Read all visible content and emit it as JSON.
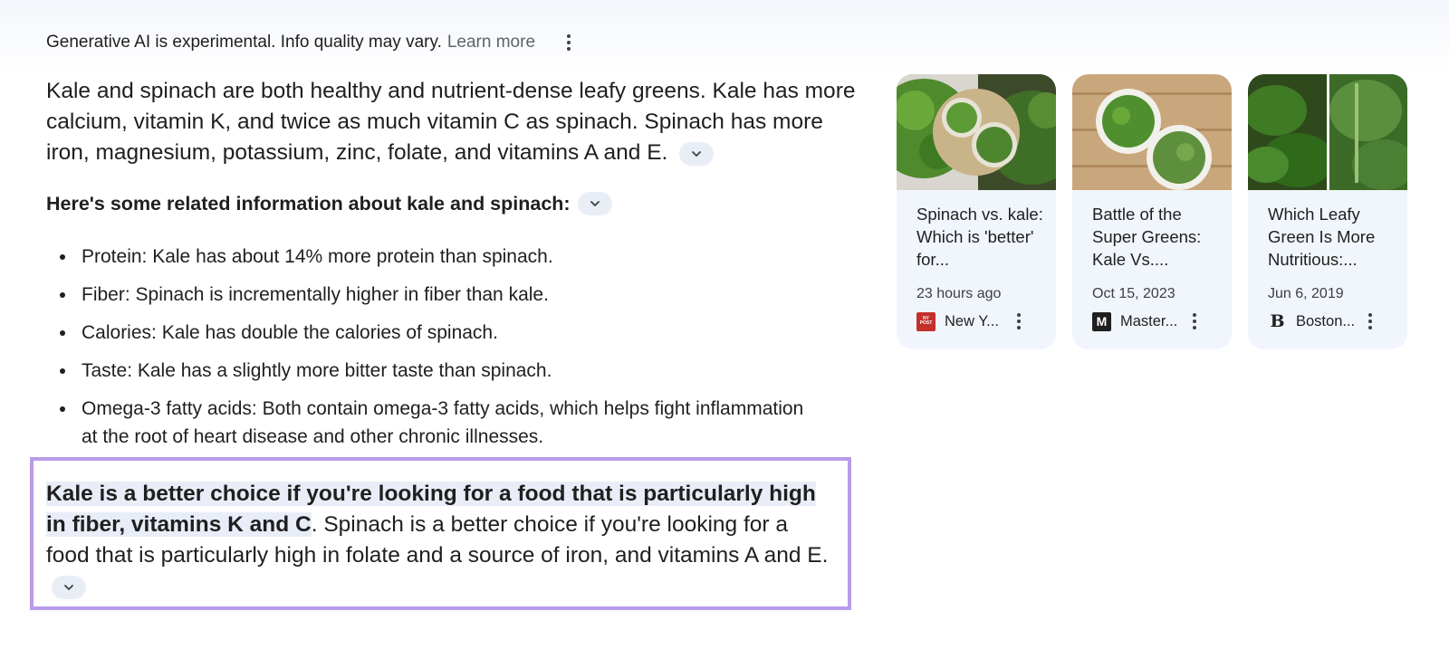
{
  "notice": {
    "text": "Generative AI is experimental. Info quality may vary.",
    "link": "Learn more",
    "menu_icon": "more-vert-icon"
  },
  "summary": "Kale and spinach are both healthy and nutrient-dense leafy greens. Kale has more calcium, vitamin K, and twice as much vitamin C as spinach. Spinach has more iron, magnesium, potassium, zinc, folate, and vitamins A and E.",
  "related_heading": "Here's some related information about kale and spinach:",
  "bullets": [
    "Protein: Kale has about 14% more protein than spinach.",
    "Fiber: Spinach is incrementally higher in fiber than kale.",
    "Calories: Kale has double the calories of spinach.",
    "Taste: Kale has a slightly more bitter taste than spinach.",
    "Omega-3 fatty acids: Both contain omega-3 fatty acids, which helps fight inflammation at the root of heart disease and other chronic illnesses."
  ],
  "conclusion": {
    "bold": "Kale is a better choice if you're looking for a food that is particularly high in fiber, vitamins K and C",
    "rest": ". Spinach is a better choice if you're looking for a food that is particularly high in folate and a source of iron, and vitamins A and E."
  },
  "cards": [
    {
      "title": "Spinach vs. kale: Which is 'better' for...",
      "date": "23 hours ago",
      "source": "New Y...",
      "favicon_label": "NEW YORK POST",
      "favicon_color": "#c4302b"
    },
    {
      "title": "Battle of the Super Greens: Kale Vs....",
      "date": "Oct 15, 2023",
      "source": "Master...",
      "favicon_label": "M",
      "favicon_color": "#1f1f1f"
    },
    {
      "title": "Which Leafy Green Is More Nutritious:...",
      "date": "Jun 6, 2019",
      "source": "Boston...",
      "favicon_label": "B",
      "favicon_color": "#ffffff"
    }
  ],
  "colors": {
    "highlight_border": "#b79ce8",
    "card_bg": "#f1f5fc",
    "chip_bg": "#e9eef6"
  }
}
